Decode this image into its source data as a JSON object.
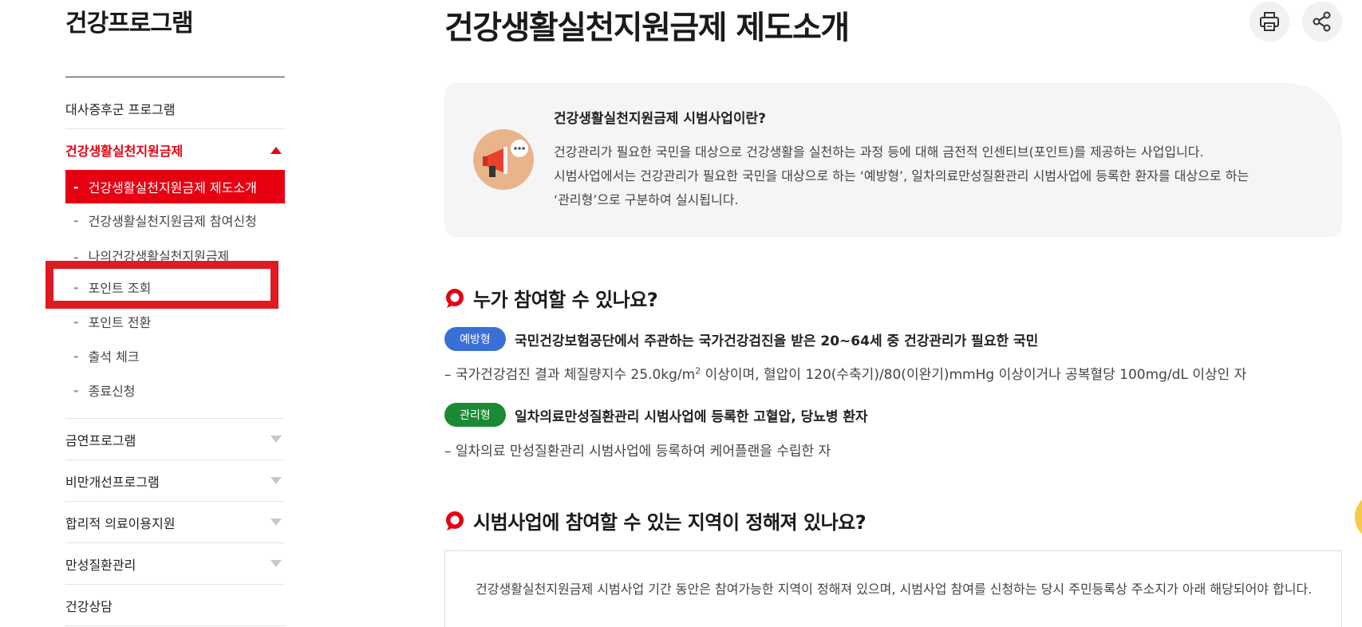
{
  "sidebar": {
    "title": "건강프로그램",
    "items": [
      {
        "label": "대사증후군 프로그램"
      },
      {
        "label": "건강생활실천지원금제"
      },
      {
        "label": "금연프로그램"
      },
      {
        "label": "비만개선프로그램"
      },
      {
        "label": "합리적 의료이용지원"
      },
      {
        "label": "만성질환관리"
      },
      {
        "label": "건강상담"
      }
    ],
    "subitems": [
      {
        "label": "건강생활실천지원금제 제도소개"
      },
      {
        "label": "건강생활실천지원금제 참여신청"
      },
      {
        "label": "나의건강생활실천지원금제"
      },
      {
        "label": "포인트 조회"
      },
      {
        "label": "포인트 전환"
      },
      {
        "label": "출석 체크"
      },
      {
        "label": "종료신청"
      }
    ],
    "dash": "-"
  },
  "main": {
    "title": "건강생활실천지원금제 제도소개",
    "intro": {
      "title": "건강생활실천지원금제 시범사업이란?",
      "line1": "건강관리가 필요한 국민을 대상으로 건강생활을 실천하는 과정 등에 대해 금전적 인센티브(포인트)를 제공하는 사업입니다.",
      "line2": "시범사업에서는 건강관리가 필요한 국민을 대상으로 하는 ‘예방형’, 일차의료만성질환관리 시범사업에 등록한 환자를 대상으로 하는",
      "line3": "‘관리형’으로 구분하여 실시됩니다."
    },
    "section1": {
      "heading": "누가 참여할 수 있나요?",
      "type1": {
        "badge": "예방형",
        "text": "국민건강보험공단에서 주관하는 국가건강검진을 받은 20~64세 중 건강관리가 필요한 국민",
        "desc_prefix": "– 국가건강검진 결과 체질량지수 25.0kg/m",
        "desc_sup": "2",
        "desc_suffix": " 이상이며, 혈압이 120(수축기)/80(이완기)mmHg 이상이거나 공복혈당 100mg/dL 이상인 자"
      },
      "type2": {
        "badge": "관리형",
        "text": "일차의료만성질환관리 시범사업에 등록한 고혈압, 당뇨병 환자",
        "desc": "– 일차의료 만성질환관리 시범사업에 등록하여 케어플랜을 수립한 자"
      }
    },
    "section2": {
      "heading": "시범사업에 참여할 수 있는 지역이 정해져 있나요?",
      "body": "건강생활실천지원금제 시범사업 기간 동안은 참여가능한 지역이 정해져 있으며, 시범사업 참여를 신청하는 당시 주민등록상 주소지가 아래 해당되어야 합니다."
    }
  },
  "colors": {
    "accent_red": "#e60012",
    "highlight_red": "#e01a22",
    "badge_blue": "#3b6fd8",
    "badge_green": "#1a8a34"
  },
  "icons": [
    "print-icon",
    "share-icon",
    "chevron-up-icon",
    "chevron-down-icon",
    "megaphone-icon",
    "speech-bubble-icon"
  ]
}
